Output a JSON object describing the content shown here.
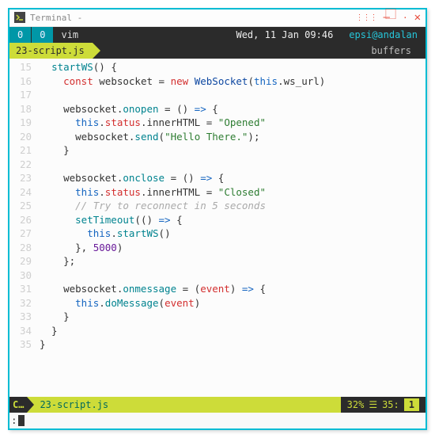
{
  "window": {
    "title": "Terminal -"
  },
  "topbar": {
    "num0": "0",
    "num1": "0",
    "app": "vim",
    "date": "Wed, 11 Jan 09:46",
    "user": "epsi@andalan"
  },
  "tabs": {
    "active": "23-script.js",
    "right": "buffers"
  },
  "code": [
    {
      "n": 15,
      "segs": [
        {
          "c": "k-dark",
          "t": "  "
        },
        {
          "c": "k-teal",
          "t": "startWS"
        },
        {
          "c": "k-dark",
          "t": "() {"
        }
      ]
    },
    {
      "n": 16,
      "segs": [
        {
          "c": "k-dark",
          "t": "    "
        },
        {
          "c": "k-red",
          "t": "const"
        },
        {
          "c": "k-dark",
          "t": " websocket "
        },
        {
          "c": "k-dark",
          "t": "= "
        },
        {
          "c": "k-red",
          "t": "new"
        },
        {
          "c": "k-dark",
          "t": " "
        },
        {
          "c": "k-navy",
          "t": "WebSocket"
        },
        {
          "c": "k-dark",
          "t": "("
        },
        {
          "c": "k-blue",
          "t": "this"
        },
        {
          "c": "k-dark",
          "t": ".ws_url)"
        }
      ]
    },
    {
      "n": 17,
      "segs": [
        {
          "c": "k-dark",
          "t": ""
        }
      ]
    },
    {
      "n": 18,
      "segs": [
        {
          "c": "k-dark",
          "t": "    websocket."
        },
        {
          "c": "k-teal",
          "t": "onopen"
        },
        {
          "c": "k-dark",
          "t": " = () "
        },
        {
          "c": "k-blue",
          "t": "=>"
        },
        {
          "c": "k-dark",
          "t": " {"
        }
      ]
    },
    {
      "n": 19,
      "segs": [
        {
          "c": "k-dark",
          "t": "      "
        },
        {
          "c": "k-blue",
          "t": "this"
        },
        {
          "c": "k-dark",
          "t": "."
        },
        {
          "c": "k-red",
          "t": "status"
        },
        {
          "c": "k-dark",
          "t": ".innerHTML = "
        },
        {
          "c": "k-green",
          "t": "\"Opened\""
        }
      ]
    },
    {
      "n": 20,
      "segs": [
        {
          "c": "k-dark",
          "t": "      websocket."
        },
        {
          "c": "k-teal",
          "t": "send"
        },
        {
          "c": "k-dark",
          "t": "("
        },
        {
          "c": "k-green",
          "t": "\"Hello There.\""
        },
        {
          "c": "k-dark",
          "t": ");"
        }
      ]
    },
    {
      "n": 21,
      "segs": [
        {
          "c": "k-dark",
          "t": "    }"
        }
      ]
    },
    {
      "n": 22,
      "segs": [
        {
          "c": "k-dark",
          "t": ""
        }
      ]
    },
    {
      "n": 23,
      "segs": [
        {
          "c": "k-dark",
          "t": "    websocket."
        },
        {
          "c": "k-teal",
          "t": "onclose"
        },
        {
          "c": "k-dark",
          "t": " = () "
        },
        {
          "c": "k-blue",
          "t": "=>"
        },
        {
          "c": "k-dark",
          "t": " {"
        }
      ]
    },
    {
      "n": 24,
      "segs": [
        {
          "c": "k-dark",
          "t": "      "
        },
        {
          "c": "k-blue",
          "t": "this"
        },
        {
          "c": "k-dark",
          "t": "."
        },
        {
          "c": "k-red",
          "t": "status"
        },
        {
          "c": "k-dark",
          "t": ".innerHTML = "
        },
        {
          "c": "k-green",
          "t": "\"Closed\""
        }
      ]
    },
    {
      "n": 25,
      "segs": [
        {
          "c": "k-dark",
          "t": "      "
        },
        {
          "c": "k-gray",
          "t": "// Try to reconnect in 5 seconds"
        }
      ]
    },
    {
      "n": 26,
      "segs": [
        {
          "c": "k-dark",
          "t": "      "
        },
        {
          "c": "k-teal",
          "t": "setTimeout"
        },
        {
          "c": "k-dark",
          "t": "(() "
        },
        {
          "c": "k-blue",
          "t": "=>"
        },
        {
          "c": "k-dark",
          "t": " {"
        }
      ]
    },
    {
      "n": 27,
      "segs": [
        {
          "c": "k-dark",
          "t": "        "
        },
        {
          "c": "k-blue",
          "t": "this"
        },
        {
          "c": "k-dark",
          "t": "."
        },
        {
          "c": "k-teal",
          "t": "startWS"
        },
        {
          "c": "k-dark",
          "t": "()"
        }
      ]
    },
    {
      "n": 28,
      "segs": [
        {
          "c": "k-dark",
          "t": "      }, "
        },
        {
          "c": "k-purple",
          "t": "5000"
        },
        {
          "c": "k-dark",
          "t": ")"
        }
      ]
    },
    {
      "n": 29,
      "segs": [
        {
          "c": "k-dark",
          "t": "    };"
        }
      ]
    },
    {
      "n": 30,
      "segs": [
        {
          "c": "k-dark",
          "t": ""
        }
      ]
    },
    {
      "n": 31,
      "segs": [
        {
          "c": "k-dark",
          "t": "    websocket."
        },
        {
          "c": "k-teal",
          "t": "onmessage"
        },
        {
          "c": "k-dark",
          "t": " = ("
        },
        {
          "c": "k-red",
          "t": "event"
        },
        {
          "c": "k-dark",
          "t": ") "
        },
        {
          "c": "k-blue",
          "t": "=>"
        },
        {
          "c": "k-dark",
          "t": " {"
        }
      ]
    },
    {
      "n": 32,
      "segs": [
        {
          "c": "k-dark",
          "t": "      "
        },
        {
          "c": "k-blue",
          "t": "this"
        },
        {
          "c": "k-dark",
          "t": "."
        },
        {
          "c": "k-teal",
          "t": "doMessage"
        },
        {
          "c": "k-dark",
          "t": "("
        },
        {
          "c": "k-red",
          "t": "event"
        },
        {
          "c": "k-dark",
          "t": ")"
        }
      ]
    },
    {
      "n": 33,
      "segs": [
        {
          "c": "k-dark",
          "t": "    }"
        }
      ]
    },
    {
      "n": 34,
      "segs": [
        {
          "c": "k-dark",
          "t": "  }"
        }
      ]
    },
    {
      "n": 35,
      "segs": [
        {
          "c": "k-dark",
          "t": "}"
        }
      ]
    }
  ],
  "status": {
    "mode": "C…",
    "file": "23-script.js",
    "percent": "32%",
    "bars": "☰",
    "line": "35:",
    "col": "1"
  },
  "cmdline": {
    "prompt": ":"
  }
}
